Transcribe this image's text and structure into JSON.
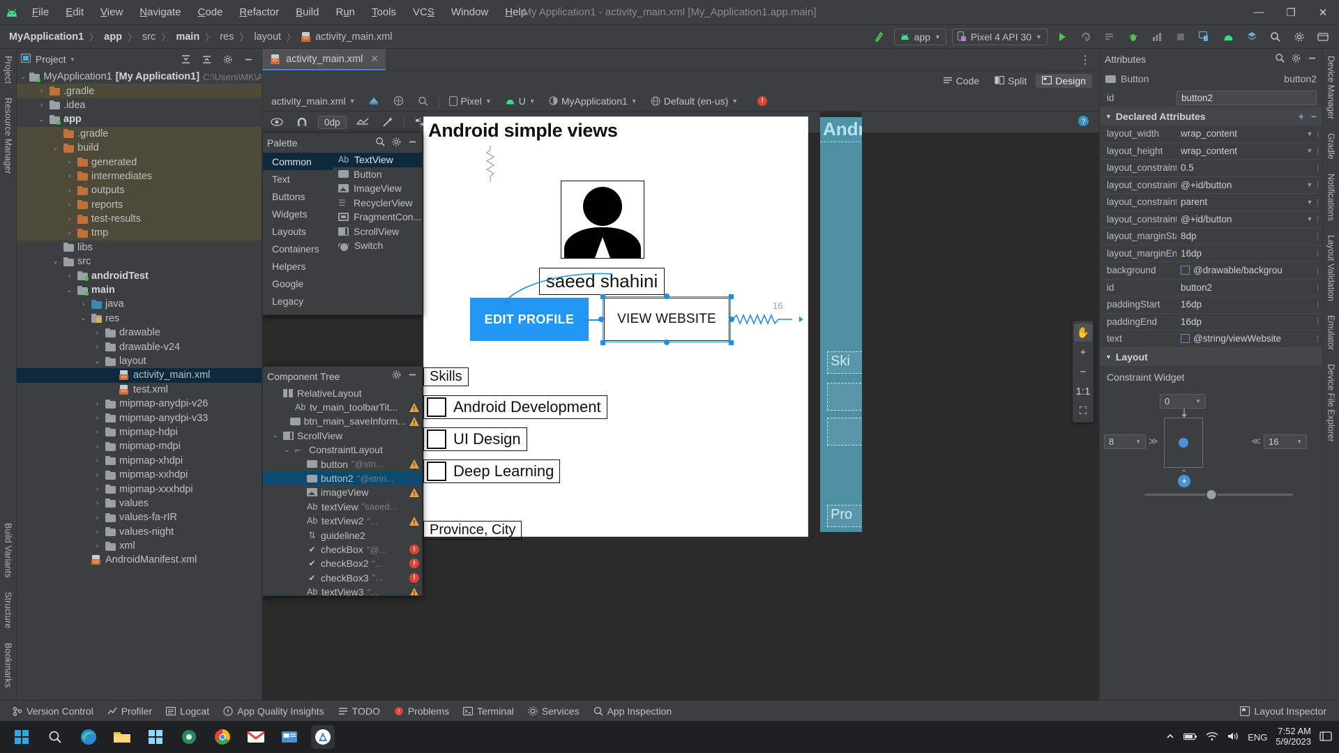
{
  "titlebar": {
    "app_icon": "android-logo-icon",
    "menus": [
      "File",
      "Edit",
      "View",
      "Navigate",
      "Code",
      "Refactor",
      "Build",
      "Run",
      "Tools",
      "VCS",
      "Window",
      "Help"
    ],
    "window_title": "My Application1 - activity_main.xml [My_Application1.app.main]",
    "minimize": "—",
    "maximize": "❐",
    "close": "✕"
  },
  "breadcrumb": {
    "items": [
      "MyApplication1",
      "app",
      "src",
      "main",
      "res",
      "layout",
      "activity_main.xml"
    ],
    "separator": "〉"
  },
  "toolbar": {
    "run_config": "app",
    "device": "Pixel 4 API 30",
    "run_label": "Run",
    "icons": [
      "make-project-icon",
      "run-icon",
      "apply-changes-icon",
      "apply-code-changes-icon",
      "debug-icon",
      "profile-icon",
      "stop-icon",
      "device-manager-icon",
      "avd-icon",
      "sdk-icon",
      "search-icon",
      "settings-icon",
      "help-icon"
    ]
  },
  "left_rail": {
    "items": [
      "Project",
      "Resource Manager"
    ],
    "bottom_items": [
      "Bookmarks",
      "Structure",
      "Build Variants"
    ]
  },
  "right_rail": {
    "items": [
      "Device Manager",
      "Gradle",
      "Notifications",
      "Layout Validation",
      "Emulator",
      "Device File Explorer"
    ]
  },
  "project_panel": {
    "title": "Project",
    "dropdown_caret": "▾",
    "actions": [
      "expand-all-icon",
      "collapse-all-icon",
      "settings-icon",
      "hide-icon"
    ],
    "tree": [
      {
        "label": "MyApplication1",
        "bold_suffix": "[My Application1]",
        "path": "C:\\Users\\MK\\Androi",
        "indent": 0,
        "arrow": "⌄",
        "icon": "module-folder",
        "highlight": false
      },
      {
        "label": ".gradle",
        "indent": 1,
        "arrow": "›",
        "icon": "folder-orange",
        "highlight": true
      },
      {
        "label": ".idea",
        "indent": 1,
        "arrow": "›",
        "icon": "folder-gray",
        "highlight": false
      },
      {
        "label": "app",
        "bold": true,
        "indent": 1,
        "arrow": "⌄",
        "icon": "module-folder",
        "highlight": false
      },
      {
        "label": ".gradle",
        "indent": 2,
        "arrow": "",
        "icon": "folder-orange",
        "highlight": true
      },
      {
        "label": "build",
        "indent": 2,
        "arrow": "⌄",
        "icon": "folder-orange",
        "highlight": true
      },
      {
        "label": "generated",
        "indent": 3,
        "arrow": "›",
        "icon": "folder-orange",
        "highlight": true
      },
      {
        "label": "intermediates",
        "indent": 3,
        "arrow": "›",
        "icon": "folder-orange",
        "highlight": true
      },
      {
        "label": "outputs",
        "indent": 3,
        "arrow": "›",
        "icon": "folder-orange",
        "highlight": true
      },
      {
        "label": "reports",
        "indent": 3,
        "arrow": "›",
        "icon": "folder-orange",
        "highlight": true
      },
      {
        "label": "test-results",
        "indent": 3,
        "arrow": "›",
        "icon": "folder-orange",
        "highlight": true
      },
      {
        "label": "tmp",
        "indent": 3,
        "arrow": "›",
        "icon": "folder-orange",
        "highlight": true
      },
      {
        "label": "libs",
        "indent": 2,
        "arrow": "",
        "icon": "folder-gray",
        "highlight": false
      },
      {
        "label": "src",
        "indent": 2,
        "arrow": "⌄",
        "icon": "folder-gray",
        "highlight": false
      },
      {
        "label": "androidTest",
        "bold": true,
        "indent": 3,
        "arrow": "›",
        "icon": "module-folder",
        "highlight": false
      },
      {
        "label": "main",
        "bold": true,
        "indent": 3,
        "arrow": "⌄",
        "icon": "module-folder",
        "highlight": false
      },
      {
        "label": "java",
        "indent": 4,
        "arrow": "›",
        "icon": "folder-blue",
        "highlight": false
      },
      {
        "label": "res",
        "indent": 4,
        "arrow": "⌄",
        "icon": "res-folder",
        "highlight": false
      },
      {
        "label": "drawable",
        "indent": 5,
        "arrow": "›",
        "icon": "folder-gray",
        "highlight": false
      },
      {
        "label": "drawable-v24",
        "indent": 5,
        "arrow": "›",
        "icon": "folder-gray",
        "highlight": false
      },
      {
        "label": "layout",
        "indent": 5,
        "arrow": "⌄",
        "icon": "folder-gray",
        "highlight": false
      },
      {
        "label": "activity_main.xml",
        "indent": 6,
        "arrow": "",
        "icon": "xml-file",
        "selected": true
      },
      {
        "label": "test.xml",
        "indent": 6,
        "arrow": "",
        "icon": "xml-file",
        "highlight": false
      },
      {
        "label": "mipmap-anydpi-v26",
        "indent": 5,
        "arrow": "›",
        "icon": "folder-gray",
        "highlight": false
      },
      {
        "label": "mipmap-anydpi-v33",
        "indent": 5,
        "arrow": "›",
        "icon": "folder-gray",
        "highlight": false
      },
      {
        "label": "mipmap-hdpi",
        "indent": 5,
        "arrow": "›",
        "icon": "folder-gray",
        "highlight": false
      },
      {
        "label": "mipmap-mdpi",
        "indent": 5,
        "arrow": "›",
        "icon": "folder-gray",
        "highlight": false
      },
      {
        "label": "mipmap-xhdpi",
        "indent": 5,
        "arrow": "›",
        "icon": "folder-gray",
        "highlight": false
      },
      {
        "label": "mipmap-xxhdpi",
        "indent": 5,
        "arrow": "›",
        "icon": "folder-gray",
        "highlight": false
      },
      {
        "label": "mipmap-xxxhdpi",
        "indent": 5,
        "arrow": "›",
        "icon": "folder-gray",
        "highlight": false
      },
      {
        "label": "values",
        "indent": 5,
        "arrow": "›",
        "icon": "folder-gray",
        "highlight": false
      },
      {
        "label": "values-fa-rIR",
        "indent": 5,
        "arrow": "›",
        "icon": "folder-gray",
        "highlight": false
      },
      {
        "label": "values-night",
        "indent": 5,
        "arrow": "›",
        "icon": "folder-gray",
        "highlight": false
      },
      {
        "label": "xml",
        "indent": 5,
        "arrow": "›",
        "icon": "folder-gray",
        "highlight": false
      },
      {
        "label": "AndroidManifest.xml",
        "indent": 4,
        "arrow": "",
        "icon": "xml-file",
        "highlight": false
      }
    ]
  },
  "editor": {
    "tab": {
      "label": "activity_main.xml",
      "close": "✕",
      "icon": "xml-file"
    },
    "more": "⋮",
    "modes": [
      {
        "label": "Code",
        "active": false,
        "icon": "code-icon"
      },
      {
        "label": "Split",
        "active": false,
        "icon": "split-icon"
      },
      {
        "label": "Design",
        "active": true,
        "icon": "design-icon"
      }
    ],
    "design_toolbar": {
      "file": "activity_main.xml",
      "device": "Pixel",
      "api": "U",
      "theme": "MyApplication1",
      "locale": "Default (en-us)",
      "error_badge": "!",
      "icons": [
        "design-surface-icon",
        "blueprint-icon",
        "orientation-icon",
        "device-icon"
      ]
    },
    "surface_tools": {
      "dp_value": "0dp",
      "icons": [
        "eye-icon",
        "magnet-icon",
        "error-icon",
        "guideline-icon",
        "align-icon",
        "distribute-icon",
        "baseline-icon"
      ],
      "help": "?"
    },
    "side_tools": [
      "pan-icon",
      "zoom-in-icon",
      "zoom-out-icon",
      "zoom-actual-icon",
      "zoom-fit-icon"
    ],
    "side_tool_labels": [
      "✋",
      "+",
      "−",
      "1:1",
      "⛶"
    ]
  },
  "preview": {
    "title": "Android simple views",
    "name_text": "saeed shahini",
    "button_edit": "EDIT PROFILE",
    "button_view": "VIEW WEBSITE",
    "skills_label": "Skills",
    "checkboxes": [
      "Android Development",
      "UI Design",
      "Deep Learning"
    ],
    "province_label": "Province, City",
    "margin_label": "16",
    "blueprint_title": "Android",
    "blueprint_skills": "Ski",
    "blueprint_province": "Pro"
  },
  "palette": {
    "title": "Palette",
    "search_icon": "search-icon",
    "settings_icon": "settings-icon",
    "hide_icon": "hide-icon",
    "categories": [
      "Common",
      "Text",
      "Buttons",
      "Widgets",
      "Layouts",
      "Containers",
      "Helpers",
      "Google",
      "Legacy"
    ],
    "selected_category": "Common",
    "items": [
      {
        "label": "TextView",
        "icon": "ab-icon",
        "selected": true
      },
      {
        "label": "Button",
        "icon": "button-icon",
        "selected": false
      },
      {
        "label": "ImageView",
        "icon": "image-icon",
        "selected": false
      },
      {
        "label": "RecyclerView",
        "icon": "list-icon",
        "selected": false
      },
      {
        "label": "FragmentCon...",
        "icon": "fragment-icon",
        "selected": false
      },
      {
        "label": "ScrollView",
        "icon": "scroll-icon",
        "selected": false
      },
      {
        "label": "Switch",
        "icon": "switch-icon",
        "selected": false
      }
    ]
  },
  "component_tree": {
    "title": "Component Tree",
    "settings_icon": "settings-icon",
    "hide_icon": "hide-icon",
    "rows": [
      {
        "label": "RelativeLayout",
        "sub": "",
        "indent": 0,
        "arrow": "",
        "icon": "relative-layout-icon",
        "badge": "",
        "selected": false
      },
      {
        "label": "tv_main_toolbarTit...",
        "sub": "",
        "indent": 1,
        "arrow": "",
        "icon": "ab-icon",
        "badge": "warn",
        "selected": false
      },
      {
        "label": "btn_main_saveInform...",
        "sub": "",
        "indent": 1,
        "arrow": "",
        "icon": "button-icon",
        "badge": "warn",
        "selected": false
      },
      {
        "label": "ScrollView",
        "sub": "",
        "indent": 0,
        "arrow": "⌄",
        "icon": "scroll-icon",
        "badge": "",
        "selected": false
      },
      {
        "label": "ConstraintLayout",
        "sub": "",
        "indent": 1,
        "arrow": "⌄",
        "icon": "constraint-icon",
        "badge": "",
        "selected": false
      },
      {
        "label": "button",
        "sub": "\"@stri...",
        "indent": 2,
        "arrow": "",
        "icon": "button-icon",
        "badge": "warn",
        "selected": false
      },
      {
        "label": "button2",
        "sub": "\"@strin...",
        "indent": 2,
        "arrow": "",
        "icon": "button-icon",
        "badge": "",
        "selected": true
      },
      {
        "label": "imageView",
        "sub": "",
        "indent": 2,
        "arrow": "",
        "icon": "image-icon",
        "badge": "warn",
        "selected": false
      },
      {
        "label": "textView",
        "sub": "\"saeed...",
        "indent": 2,
        "arrow": "",
        "icon": "ab-icon",
        "badge": "",
        "selected": false
      },
      {
        "label": "textView2",
        "sub": "\"...",
        "indent": 2,
        "arrow": "",
        "icon": "ab-icon",
        "badge": "warn",
        "selected": false
      },
      {
        "label": "guideline2",
        "sub": "",
        "indent": 2,
        "arrow": "",
        "icon": "guideline-icon",
        "badge": "",
        "selected": false
      },
      {
        "label": "checkBox",
        "sub": "\"@...",
        "indent": 2,
        "arrow": "",
        "icon": "checkbox-icon",
        "badge": "err",
        "selected": false
      },
      {
        "label": "checkBox2",
        "sub": "\"...",
        "indent": 2,
        "arrow": "",
        "icon": "checkbox-icon",
        "badge": "err",
        "selected": false
      },
      {
        "label": "checkBox3",
        "sub": "\"...",
        "indent": 2,
        "arrow": "",
        "icon": "checkbox-icon",
        "badge": "err",
        "selected": false
      },
      {
        "label": "textView3",
        "sub": "\"...",
        "indent": 2,
        "arrow": "",
        "icon": "ab-icon",
        "badge": "warn",
        "selected": false
      }
    ]
  },
  "attributes": {
    "title": "Attributes",
    "search_icon": "search-icon",
    "settings_icon": "settings-icon",
    "hide_icon": "hide-icon",
    "component_type": "Button",
    "component_id": "button2",
    "id_label": "id",
    "id_value": "button2",
    "declared_section": "Declared Attributes",
    "add_icon": "+",
    "remove_icon": "−",
    "rows": [
      {
        "key": "layout_width",
        "value": "wrap_content",
        "caret": true,
        "chip": false
      },
      {
        "key": "layout_height",
        "value": "wrap_content",
        "caret": true,
        "chip": false
      },
      {
        "key": "layout_constraint...",
        "value": "0.5",
        "caret": false,
        "chip": false
      },
      {
        "key": "layout_constraintS...",
        "value": "@+id/button",
        "caret": true,
        "chip": false
      },
      {
        "key": "layout_constraintE...",
        "value": "parent",
        "caret": true,
        "chip": false
      },
      {
        "key": "layout_constraintT...",
        "value": "@+id/button",
        "caret": true,
        "chip": false
      },
      {
        "key": "layout_marginStart",
        "value": "8dp",
        "caret": false,
        "chip": false
      },
      {
        "key": "layout_marginEnd",
        "value": "16dp",
        "caret": false,
        "chip": false
      },
      {
        "key": "background",
        "value": "@drawable/backgrou",
        "caret": false,
        "chip": true
      },
      {
        "key": "id",
        "value": "button2",
        "caret": false,
        "chip": false
      },
      {
        "key": "paddingStart",
        "value": "16dp",
        "caret": false,
        "chip": false
      },
      {
        "key": "paddingEnd",
        "value": "16dp",
        "caret": false,
        "chip": false
      },
      {
        "key": "text",
        "value": "@string/viewWebsite",
        "caret": false,
        "chip": true
      }
    ],
    "layout_section": "Layout",
    "constraint_widget_label": "Constraint Widget",
    "cw_top": "0",
    "cw_left": "8",
    "cw_right": "16",
    "cw_center": "+",
    "cw_arrow_left": "≫",
    "cw_arrow_right": "≪",
    "cw_up": "⌃",
    "cw_down": "⌄"
  },
  "statusbar": {
    "items": [
      {
        "label": "Version Control",
        "icon": "vcs-icon"
      },
      {
        "label": "Profiler",
        "icon": "profiler-icon"
      },
      {
        "label": "Logcat",
        "icon": "logcat-icon"
      },
      {
        "label": "App Quality Insights",
        "icon": "insights-icon"
      },
      {
        "label": "TODO",
        "icon": "todo-icon"
      },
      {
        "label": "Problems",
        "icon": "problems-icon"
      },
      {
        "label": "Terminal",
        "icon": "terminal-icon"
      },
      {
        "label": "Services",
        "icon": "services-icon"
      },
      {
        "label": "App Inspection",
        "icon": "inspection-icon"
      }
    ],
    "right_label": "Layout Inspector",
    "right_icon": "layout-inspector-icon"
  },
  "taskbar": {
    "start_icon": "windows-start-icon",
    "search_icon": "search-icon",
    "apps": [
      "edge-icon",
      "file-explorer-icon",
      "store-icon",
      "settings-app-icon",
      "chrome-icon",
      "gmail-icon",
      "news-icon",
      "android-studio-icon"
    ],
    "tray": [
      "chevron-up-icon",
      "battery-icon",
      "wifi-icon",
      "volume-icon"
    ],
    "language": "ENG",
    "time": "7:52 AM",
    "date": "5/9/2023",
    "notification_icon": "notification-icon"
  },
  "colors": {
    "accent_blue": "#2196f3",
    "selection_blue": "#0d4a72",
    "panel_bg": "#3c3f41",
    "surface_bg": "#2b2b2b",
    "folder_orange": "#c2703a",
    "error_red": "#db4437",
    "warn_orange": "#e8a33d",
    "green": "#4ec14e",
    "blueprint": "#4d8fa3"
  }
}
